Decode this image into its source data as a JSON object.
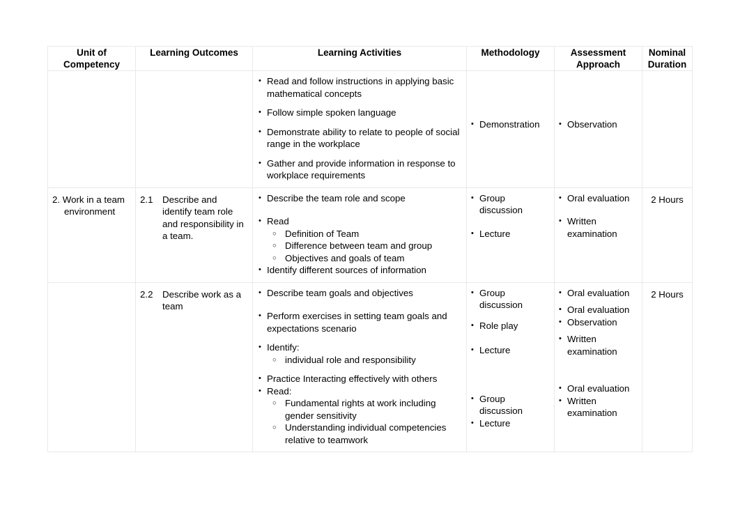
{
  "document": {
    "type": "curriculum-session-plan-table"
  },
  "table": {
    "headers": [
      "Unit of\nCompetency",
      "Learning Outcomes",
      "Learning Activities",
      "Methodology",
      "Assessment\nApproach",
      "Nominal\nDuration"
    ],
    "headers_plain": {
      "unit_line1": "Unit of",
      "unit_line2": "Competency",
      "outcomes": "Learning Outcomes",
      "activities": "Learning Activities",
      "methodology": "Methodology",
      "assessment_line1": "Assessment",
      "assessment_line2": "Approach",
      "duration_line1": "Nominal",
      "duration_line2": "Duration"
    },
    "rows": [
      {
        "unit": "",
        "outcome_number": "",
        "outcome_text": "",
        "activities": [
          {
            "text": "Read and follow instructions in applying basic mathematical concepts"
          },
          {
            "text": "Follow simple spoken language"
          },
          {
            "text": "Demonstrate ability to relate to people of social range in the workplace"
          },
          {
            "text": "Gather and provide information in response to workplace requirements"
          }
        ],
        "methodology": [
          "Demonstration"
        ],
        "assessment": [
          "Observation"
        ],
        "duration": ""
      },
      {
        "unit": "2. Work in a team environment",
        "unit_number": "2.",
        "unit_label": "Work in a team environment",
        "outcome_number": "2.1",
        "outcome_text": "Describe and identify team role and responsibility in a team.",
        "activities": [
          {
            "text": "Describe the team role and scope",
            "sub": []
          },
          {
            "text": "Read",
            "sub": [
              "Definition of Team",
              "Difference between team and group",
              "Objectives and goals of team"
            ]
          },
          {
            "text": "Identify different sources of information",
            "sub": []
          }
        ],
        "methodology": [
          "Group discussion",
          "Lecture"
        ],
        "assessment": [
          "Oral evaluation",
          "Written examination"
        ],
        "duration": "2 Hours"
      },
      {
        "unit": "",
        "outcome_number": "2.2",
        "outcome_text": "Describe  work as a team",
        "activities": [
          {
            "text": "Describe team goals and objectives",
            "sub": []
          },
          {
            "text": "Perform exercises in setting team goals and expectations scenario",
            "sub": []
          },
          {
            "text": "Identify:",
            "sub": [
              "individual role and responsibility"
            ]
          },
          {
            "text": "Practice Interacting effectively with others",
            "sub": []
          },
          {
            "text": "Read:",
            "sub": [
              "Fundamental rights at work including gender sensitivity",
              "Understanding individual competencies relative to teamwork"
            ]
          }
        ],
        "methodology_groups": [
          {
            "items": [
              "Group discussion"
            ]
          },
          {
            "items": [
              "Role play"
            ]
          },
          {
            "items": [
              "Lecture"
            ]
          },
          {
            "items": [
              "Group discussion",
              "Lecture"
            ]
          }
        ],
        "assessment_groups": [
          {
            "items": [
              "Oral evaluation"
            ]
          },
          {
            "items": [
              "Oral evaluation",
              "Observation"
            ]
          },
          {
            "items": [
              "Written examination"
            ]
          },
          {
            "items": [
              "Oral evaluation",
              "Written examination"
            ]
          }
        ],
        "duration": "2 Hours"
      }
    ]
  },
  "colors": {
    "text": "#000000",
    "border": "#e9e9e9",
    "background": "#ffffff"
  }
}
